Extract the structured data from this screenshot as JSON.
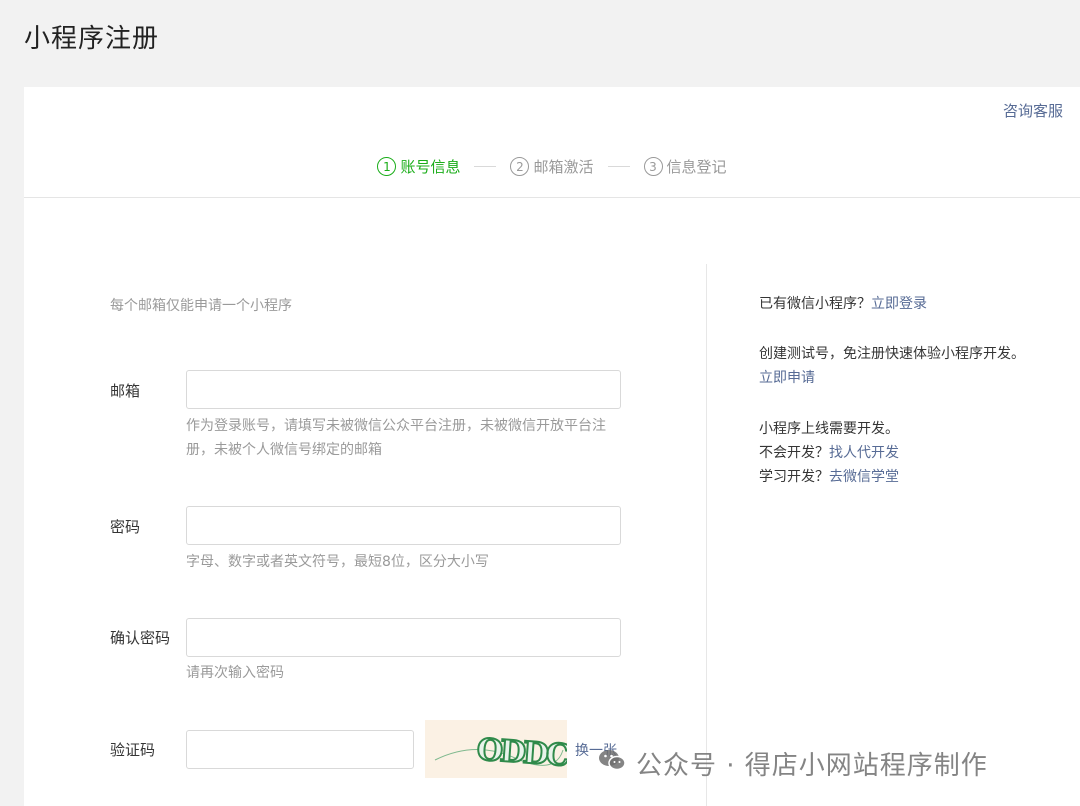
{
  "page": {
    "title": "小程序注册"
  },
  "header": {
    "consult": "咨询客服"
  },
  "steps": [
    {
      "num": "1",
      "label": "账号信息"
    },
    {
      "num": "2",
      "label": "邮箱激活"
    },
    {
      "num": "3",
      "label": "信息登记"
    }
  ],
  "form": {
    "notice": "每个邮箱仅能申请一个小程序",
    "email": {
      "label": "邮箱",
      "value": "",
      "tip": "作为登录账号，请填写未被微信公众平台注册，未被微信开放平台注册，未被个人微信号绑定的邮箱"
    },
    "password": {
      "label": "密码",
      "value": "",
      "tip": "字母、数字或者英文符号，最短8位，区分大小写"
    },
    "confirm": {
      "label": "确认密码",
      "value": "",
      "tip": "请再次输入密码"
    },
    "captcha": {
      "label": "验证码",
      "value": "",
      "code": "ODDC",
      "swap": "换一张"
    }
  },
  "side": {
    "have_account": "已有微信小程序？",
    "login": "立即登录",
    "test_prefix": "创建测试号，免注册快速体验小程序开发。",
    "test_link": "立即申请",
    "need_dev": "小程序上线需要开发。",
    "no_dev": "不会开发？",
    "find_dev": "找人代开发",
    "learn": "学习开发？",
    "academy": "去微信学堂"
  },
  "watermark": {
    "text": "公众号 · 得店小网站程序制作"
  },
  "colors": {
    "accent_green": "#1aad19",
    "link_blue": "#576b95"
  }
}
